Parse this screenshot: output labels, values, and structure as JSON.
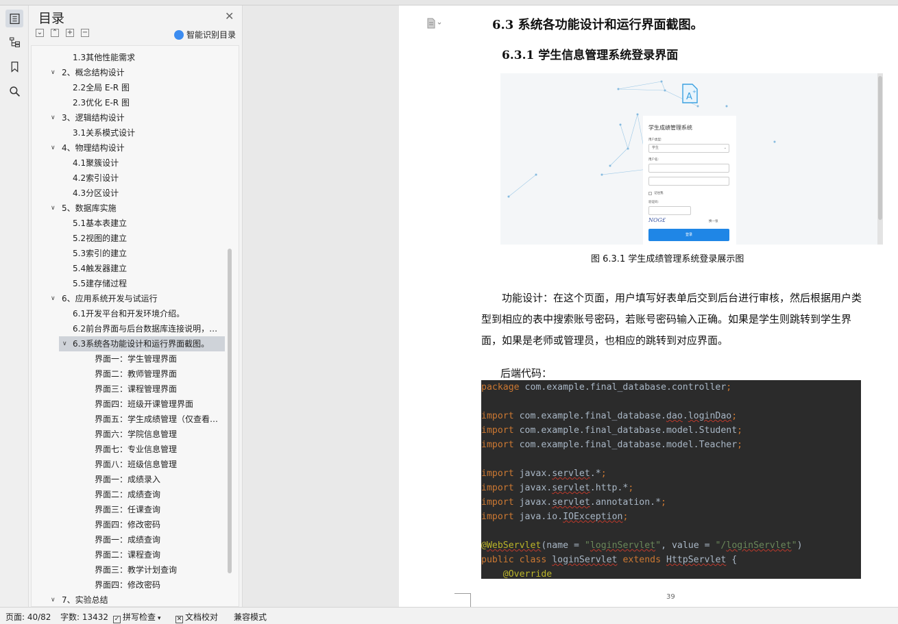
{
  "toc": {
    "title": "目录",
    "smart_label": "智能识别目录",
    "items": [
      {
        "label": "1.3其他性能需求",
        "level": 2,
        "selected": false
      },
      {
        "label": "2、概念结构设计",
        "level": 1,
        "selected": false
      },
      {
        "label": "2.2全局 E-R 图",
        "level": 2,
        "selected": false
      },
      {
        "label": "2.3优化 E-R 图",
        "level": 2,
        "selected": false
      },
      {
        "label": "3、逻辑结构设计",
        "level": 1,
        "selected": false
      },
      {
        "label": "3.1关系模式设计",
        "level": 2,
        "selected": false
      },
      {
        "label": "4、物理结构设计",
        "level": 1,
        "selected": false
      },
      {
        "label": "4.1聚簇设计",
        "level": 2,
        "selected": false
      },
      {
        "label": "4.2索引设计",
        "level": 2,
        "selected": false
      },
      {
        "label": "4.3分区设计",
        "level": 2,
        "selected": false
      },
      {
        "label": "5、数据库实施",
        "level": 1,
        "selected": false
      },
      {
        "label": "5.1基本表建立",
        "level": 2,
        "selected": false
      },
      {
        "label": "5.2视图的建立",
        "level": 2,
        "selected": false
      },
      {
        "label": "5.3索引的建立",
        "level": 2,
        "selected": false
      },
      {
        "label": "5.4触发器建立",
        "level": 2,
        "selected": false
      },
      {
        "label": "5.5建存储过程",
        "level": 2,
        "selected": false
      },
      {
        "label": "6、应用系统开发与试运行",
        "level": 1,
        "selected": false
      },
      {
        "label": "6.1开发平台和开发环境介绍。",
        "level": 2,
        "selected": false
      },
      {
        "label": "6.2前台界面与后台数据库连接说明，…",
        "level": 2,
        "selected": false
      },
      {
        "label": "6.3系统各功能设计和运行界面截图。",
        "level": 2,
        "selected": true
      },
      {
        "label": "界面一：学生管理界面",
        "level": 3,
        "selected": false
      },
      {
        "label": "界面二：教师管理界面",
        "level": 3,
        "selected": false
      },
      {
        "label": "界面三：课程管理界面",
        "level": 3,
        "selected": false
      },
      {
        "label": "界面四：班级开课管理界面",
        "level": 3,
        "selected": false
      },
      {
        "label": "界面五：学生成绩管理（仅查看…",
        "level": 3,
        "selected": false
      },
      {
        "label": "界面六：学院信息管理",
        "level": 3,
        "selected": false
      },
      {
        "label": "界面七：专业信息管理",
        "level": 3,
        "selected": false
      },
      {
        "label": "界面八：班级信息管理",
        "level": 3,
        "selected": false
      },
      {
        "label": "界面一：成绩录入",
        "level": 3,
        "selected": false
      },
      {
        "label": "界面二：成绩查询",
        "level": 3,
        "selected": false
      },
      {
        "label": "界面三：任课查询",
        "level": 3,
        "selected": false
      },
      {
        "label": "界面四：修改密码",
        "level": 3,
        "selected": false
      },
      {
        "label": "界面一：成绩查询",
        "level": 3,
        "selected": false
      },
      {
        "label": "界面二：课程查询",
        "level": 3,
        "selected": false
      },
      {
        "label": "界面三：教学计划查询",
        "level": 3,
        "selected": false
      },
      {
        "label": "界面四：修改密码",
        "level": 3,
        "selected": false
      },
      {
        "label": "7、实验总结",
        "level": 1,
        "selected": false
      }
    ]
  },
  "doc": {
    "heading": "6.3  系统各功能设计和运行界面截图。",
    "subheading": "6.3.1 学生信息管理系统登录界面",
    "figure_caption": "图 6.3.1  学生成绩管理系统登录展示图",
    "paragraph": "功能设计：在这个页面，用户填写好表单后交到后台进行审核，然后根据用户类型到相应的表中搜索账号密码，若账号密码输入正确。如果是学生则跳转到学生界面，如果是老师或管理员，也相应的跳转到对应界面。",
    "code_heading": "后端代码：",
    "page_number": "39"
  },
  "login_shot": {
    "title": "学生成绩管理系统",
    "user_type_label": "用户类型:",
    "user_type_value": "学生",
    "username_label": "用户名:",
    "remember_label": "记住我",
    "captcha_label": "验证码:",
    "captcha_text": "NOG£",
    "change_label": "换一张",
    "login_button": "登录"
  },
  "code": {
    "lines": [
      [
        {
          "t": "package",
          "c": "kw"
        },
        {
          "t": " com.example.final_database.controller",
          "c": ""
        },
        {
          "t": ";",
          "c": "kw"
        }
      ],
      [],
      [
        {
          "t": "import",
          "c": "kw"
        },
        {
          "t": " com.example.final_database.",
          "c": ""
        },
        {
          "t": "dao",
          "c": "sq"
        },
        {
          "t": ".",
          "c": ""
        },
        {
          "t": "loginDao",
          "c": "sq"
        },
        {
          "t": ";",
          "c": "kw"
        }
      ],
      [
        {
          "t": "import",
          "c": "kw"
        },
        {
          "t": " com.example.final_database.model.Student",
          "c": ""
        },
        {
          "t": ";",
          "c": "kw"
        }
      ],
      [
        {
          "t": "import",
          "c": "kw"
        },
        {
          "t": " com.example.final_database.model.Teacher",
          "c": ""
        },
        {
          "t": ";",
          "c": "kw"
        }
      ],
      [],
      [
        {
          "t": "import",
          "c": "kw"
        },
        {
          "t": " javax.",
          "c": ""
        },
        {
          "t": "servlet",
          "c": "sq"
        },
        {
          "t": ".*",
          "c": ""
        },
        {
          "t": ";",
          "c": "kw"
        }
      ],
      [
        {
          "t": "import",
          "c": "kw"
        },
        {
          "t": " javax.",
          "c": ""
        },
        {
          "t": "servlet",
          "c": "sq"
        },
        {
          "t": ".http.*",
          "c": ""
        },
        {
          "t": ";",
          "c": "kw"
        }
      ],
      [
        {
          "t": "import",
          "c": "kw"
        },
        {
          "t": " javax.",
          "c": ""
        },
        {
          "t": "servlet",
          "c": "sq"
        },
        {
          "t": ".annotation.*",
          "c": ""
        },
        {
          "t": ";",
          "c": "kw"
        }
      ],
      [
        {
          "t": "import",
          "c": "kw"
        },
        {
          "t": " java.io.",
          "c": ""
        },
        {
          "t": "IOException",
          "c": "sq"
        },
        {
          "t": ";",
          "c": "kw"
        }
      ],
      [],
      [
        {
          "t": "@",
          "c": "ann"
        },
        {
          "t": "WebServlet",
          "c": "ann sq"
        },
        {
          "t": "(name = ",
          "c": ""
        },
        {
          "t": "\"",
          "c": "str"
        },
        {
          "t": "loginServlet",
          "c": "str sq"
        },
        {
          "t": "\"",
          "c": "str"
        },
        {
          "t": ", value = ",
          "c": ""
        },
        {
          "t": "\"/",
          "c": "str"
        },
        {
          "t": "loginServlet",
          "c": "str sq"
        },
        {
          "t": "\"",
          "c": "str"
        },
        {
          "t": ")",
          "c": ""
        }
      ],
      [
        {
          "t": "public class ",
          "c": "kw"
        },
        {
          "t": "loginServlet",
          "c": "sq"
        },
        {
          "t": " ",
          "c": ""
        },
        {
          "t": "extends ",
          "c": "kw"
        },
        {
          "t": "HttpServlet",
          "c": "sq"
        },
        {
          "t": " {",
          "c": ""
        }
      ],
      [
        {
          "t": "    @Override",
          "c": "ann"
        }
      ]
    ]
  },
  "status": {
    "page": "页面: 40/82",
    "words": "字数: 13432",
    "spell": "拼写检查",
    "proof": "文档校对",
    "compat": "兼容模式"
  },
  "colors": {
    "accent": "#1f86e6",
    "code_bg": "#2b2b2b",
    "keyword": "#cc7832",
    "annotation": "#bbb529",
    "string": "#6a8759",
    "selected_toc": "#cfd3d9"
  }
}
